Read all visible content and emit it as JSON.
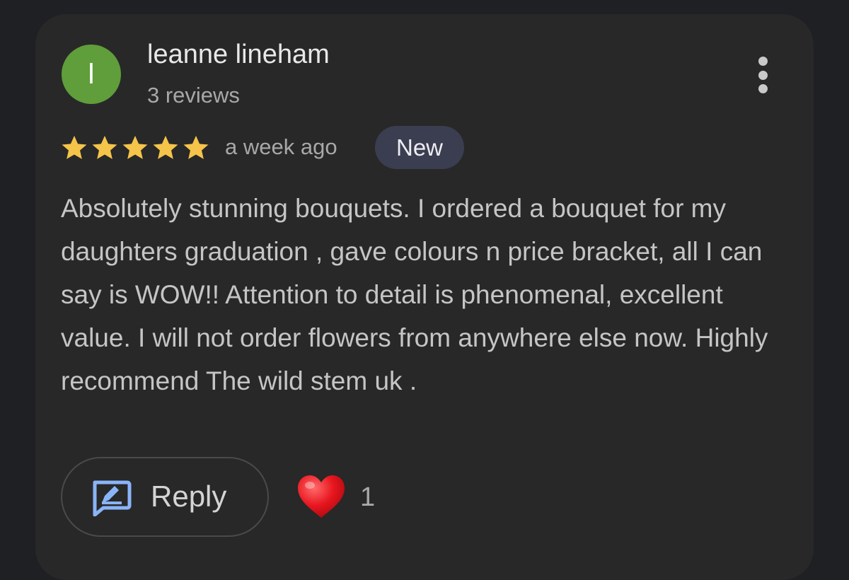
{
  "reviewer": {
    "initial": "l",
    "name": "leanne lineham",
    "review_count": "3 reviews",
    "avatar_color": "#5f9e3a"
  },
  "rating": {
    "stars": 5,
    "max_stars": 5,
    "star_color": "#f5c44a"
  },
  "timestamp": "a week ago",
  "badge": "New",
  "review_text": "Absolutely stunning bouquets. I ordered a bouquet for my daughters graduation , gave colours n price bracket, all I can say is WOW!! Attention to detail is phenomenal, excellent value. I will not order flowers from anywhere else now. Highly recommend The wild stem uk .",
  "actions": {
    "reply_label": "Reply",
    "reply_icon": "reply-icon",
    "like_icon": "heart-icon",
    "like_count": "1",
    "accent_color": "#8ab4f8"
  },
  "menu_icon": "more-vert-icon"
}
